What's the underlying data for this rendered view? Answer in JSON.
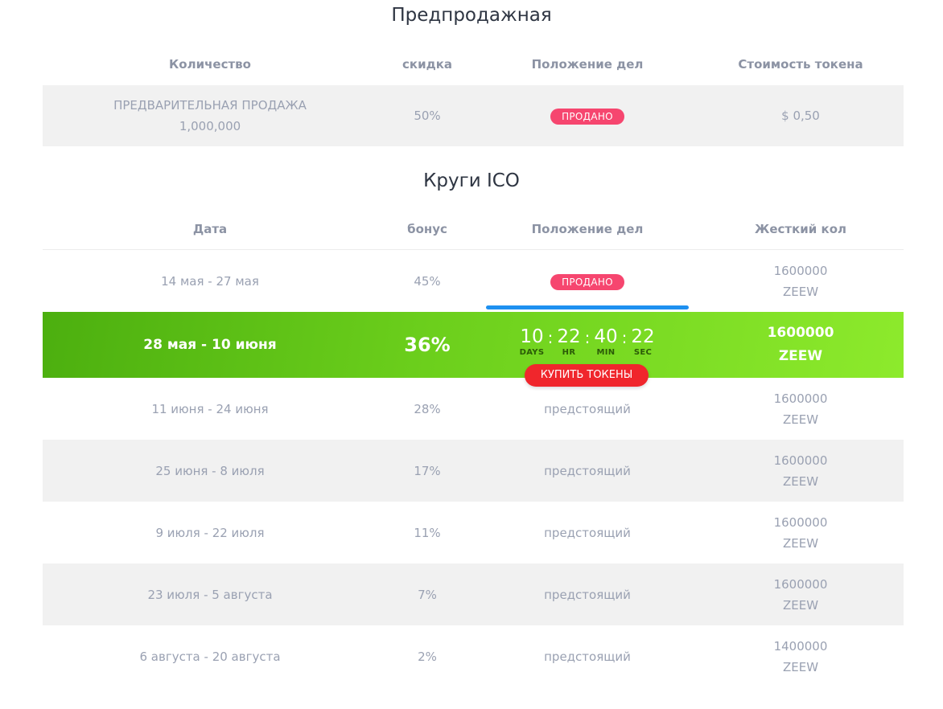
{
  "presale": {
    "title": "Предпродажная",
    "headers": [
      "Количество",
      "скидка",
      "Положение дел",
      "Стоимость токена"
    ],
    "row": {
      "quantity_line1": "ПРЕДВАРИТЕЛЬНАЯ ПРОДАЖА",
      "quantity_line2": "1,000,000",
      "discount": "50%",
      "status": "ПРОДАНО",
      "price": "$ 0,50"
    }
  },
  "ico": {
    "title": "Круги ICO",
    "headers": [
      "Дата",
      "бонус",
      "Положение дел",
      "Жесткий кол"
    ],
    "rows": [
      {
        "date": "14 мая - 27 мая",
        "bonus": "45%",
        "status": "ПРОДАНО",
        "cap_amount": "1600000",
        "cap_unit": "ZEEW"
      },
      {
        "date": "28 мая - 10 июня",
        "bonus": "36%",
        "status": "",
        "cap_amount": "1600000",
        "cap_unit": "ZEEW"
      },
      {
        "date": "11 июня - 24 июня",
        "bonus": "28%",
        "status": "предстоящий",
        "cap_amount": "1600000",
        "cap_unit": "ZEEW"
      },
      {
        "date": "25 июня - 8 июля",
        "bonus": "17%",
        "status": "предстоящий",
        "cap_amount": "1600000",
        "cap_unit": "ZEEW"
      },
      {
        "date": "9 июля - 22 июля",
        "bonus": "11%",
        "status": "предстоящий",
        "cap_amount": "1600000",
        "cap_unit": "ZEEW"
      },
      {
        "date": "23 июля - 5 августа",
        "bonus": "7%",
        "status": "предстоящий",
        "cap_amount": "1600000",
        "cap_unit": "ZEEW"
      },
      {
        "date": "6 августа - 20 августа",
        "bonus": "2%",
        "status": "предстоящий",
        "cap_amount": "1400000",
        "cap_unit": "ZEEW"
      }
    ],
    "countdown": {
      "days": "10",
      "hours": "22",
      "minutes": "40",
      "seconds": "22",
      "days_label": "DAYS",
      "hours_label": "HR",
      "minutes_label": "MIN",
      "seconds_label": "SEC",
      "separator": ":"
    },
    "buy_button": "КУПИТЬ ТОКЕНЫ"
  },
  "colors": {
    "active_row_gradient": [
      "#4caf0f",
      "#8dea2c"
    ],
    "sold_badge": "#f6466f",
    "buy_button": "#f0262c",
    "progress_bar": "#1e90f0"
  }
}
